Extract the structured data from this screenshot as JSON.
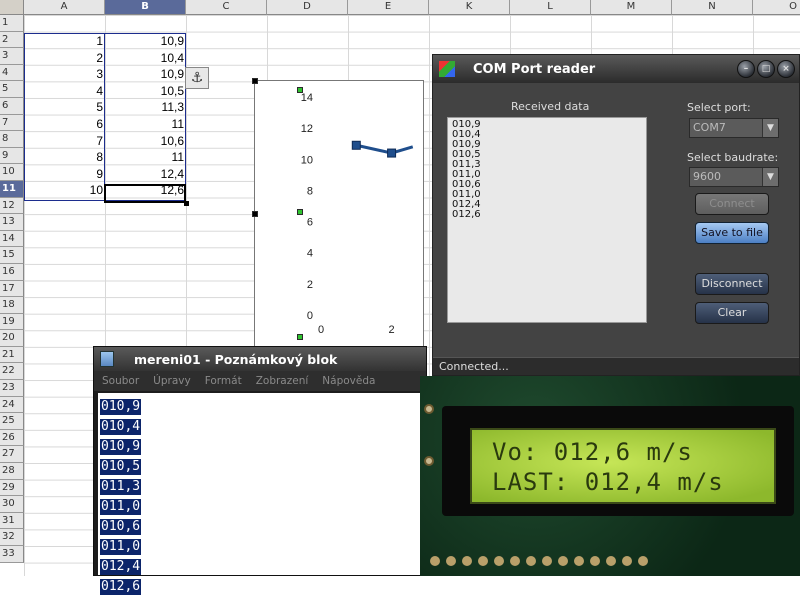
{
  "spreadsheet": {
    "columns": [
      "A",
      "B",
      "C",
      "D",
      "E",
      "K",
      "L",
      "M",
      "N",
      "O"
    ],
    "rows": [
      "1",
      "2",
      "3",
      "4",
      "5",
      "6",
      "7",
      "8",
      "9",
      "10",
      "11",
      "12",
      "13",
      "14",
      "15",
      "16",
      "17",
      "18",
      "19",
      "20",
      "21",
      "22",
      "23",
      "24",
      "25",
      "26",
      "27",
      "28",
      "29",
      "30",
      "31",
      "32",
      "33"
    ],
    "selected_column": "B",
    "selected_row": "11",
    "data": [
      {
        "a": "1",
        "b": "10,9"
      },
      {
        "a": "2",
        "b": "10,4"
      },
      {
        "a": "3",
        "b": "10,9"
      },
      {
        "a": "4",
        "b": "10,5"
      },
      {
        "a": "5",
        "b": "11,3"
      },
      {
        "a": "6",
        "b": "11"
      },
      {
        "a": "7",
        "b": "10,6"
      },
      {
        "a": "8",
        "b": "11"
      },
      {
        "a": "9",
        "b": "12,4"
      },
      {
        "a": "10",
        "b": "12,6"
      }
    ],
    "anchor_icon": "anchor-icon"
  },
  "chart_data": {
    "type": "line",
    "x": [
      1,
      2
    ],
    "series": [
      {
        "values": [
          10.9,
          10.4
        ]
      }
    ],
    "ylim": [
      0,
      14
    ],
    "yticks": [
      "14",
      "12",
      "10",
      "8",
      "6",
      "4",
      "2",
      "0"
    ],
    "xticks": [
      "0",
      "2"
    ],
    "color": "#1f4e8c",
    "title": "",
    "xlabel": "",
    "ylabel": ""
  },
  "com_reader": {
    "title": "COM Port reader",
    "received_label": "Received data",
    "received_lines": [
      "010,9",
      "010,4",
      "010,9",
      "010,5",
      "011,3",
      "011,0",
      "010,6",
      "011,0",
      "012,4",
      "012,6"
    ],
    "port_label": "Select port:",
    "port_value": "COM7",
    "baud_label": "Select baudrate:",
    "baud_value": "9600",
    "connect_label": "Connect",
    "save_label": "Save to file",
    "disconnect_label": "Disconnect",
    "clear_label": "Clear",
    "status": "Connected..."
  },
  "notepad": {
    "title": "mereni01 - Poznámkový blok",
    "menu": [
      "Soubor",
      "Úpravy",
      "Formát",
      "Zobrazení",
      "Nápověda"
    ],
    "lines": [
      "010,9",
      "010,4",
      "010,9",
      "010,5",
      "011,3",
      "011,0",
      "010,6",
      "011,0",
      "012,4",
      "012,6"
    ]
  },
  "lcd": {
    "line1": "Vo: 012,6 m/s",
    "line2": "LAST: 012,4 m/s"
  }
}
